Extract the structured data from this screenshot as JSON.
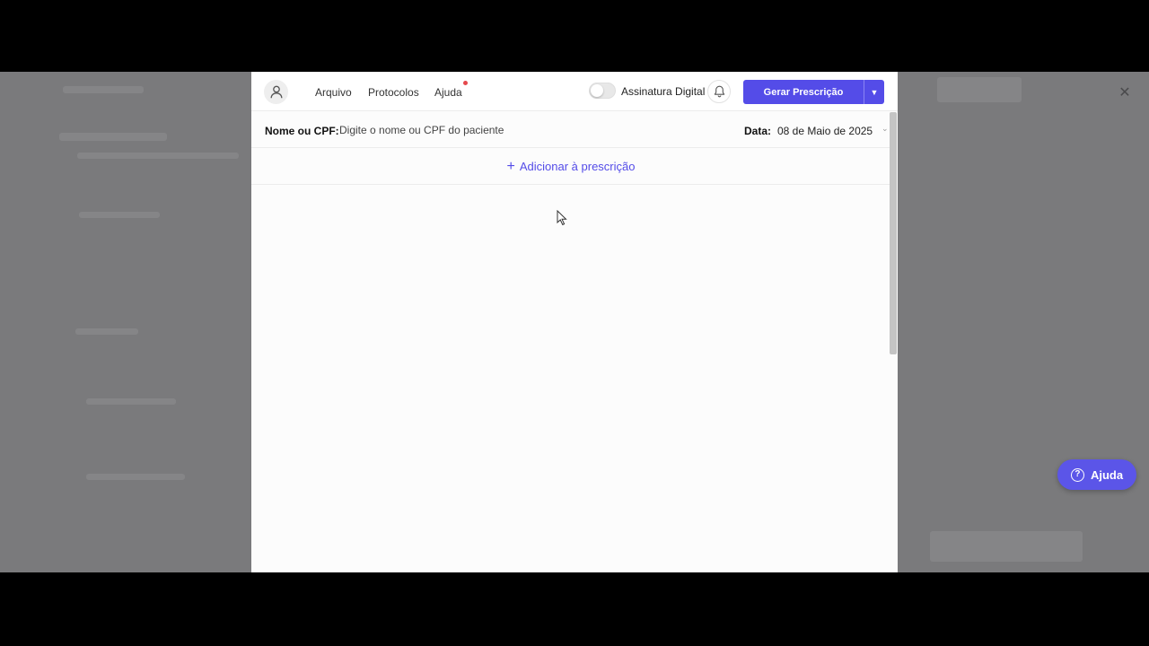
{
  "topbar": {
    "menu": [
      "Arquivo",
      "Protocolos",
      "Ajuda"
    ],
    "signature_label": "Assinatura Digital",
    "signature_enabled": false,
    "primary_button_label": "Gerar Prescrição",
    "icons": {
      "avatar": "user-icon",
      "bell": "bell-icon",
      "dropdown": "caret-down-icon"
    }
  },
  "patient": {
    "label": "Nome ou CPF:",
    "placeholder": "Digite o nome ou CPF do paciente",
    "value": ""
  },
  "date": {
    "label": "Data:",
    "value": "08 de Maio de 2025"
  },
  "prescription": {
    "add_label": "Adicionar à prescrição",
    "plus_icon": "plus-icon"
  },
  "help_button": {
    "label": "Ajuda",
    "icon": "question-icon"
  },
  "colors": {
    "accent": "#544ce8",
    "notification": "#e5484d",
    "overlay": "#7a7a7c"
  }
}
